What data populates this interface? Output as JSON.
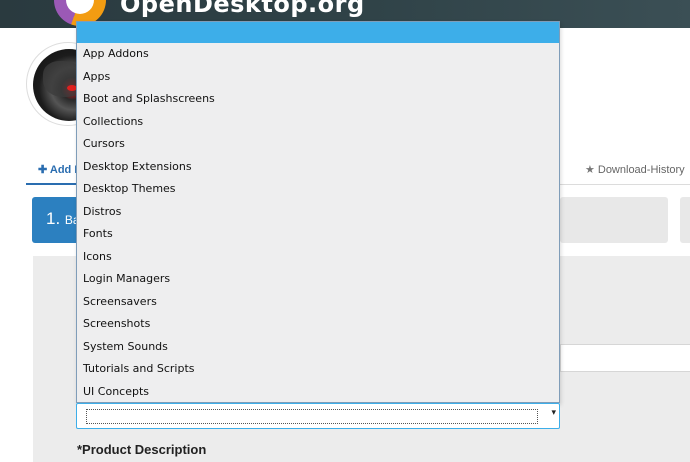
{
  "header": {
    "site_name": "OpenDesktop.org"
  },
  "tabs": {
    "add_label": "Add P",
    "history_label": "Download-History"
  },
  "steps": {
    "step1_number": "1.",
    "step1_label": "Ba"
  },
  "form": {
    "description_label": "*Product Description"
  },
  "category_dropdown": {
    "selected_value": "",
    "options": [
      "App Addons",
      "Apps",
      "Boot and Splashscreens",
      "Collections",
      "Cursors",
      "Desktop Extensions",
      "Desktop Themes",
      "Distros",
      "Fonts",
      "Icons",
      "Login Managers",
      "Screensavers",
      "Screenshots",
      "System Sounds",
      "Tutorials and Scripts",
      "UI Concepts"
    ]
  },
  "colors": {
    "accent": "#3daee9",
    "primary": "#2c80c0",
    "header_bg": "#2f4247"
  }
}
